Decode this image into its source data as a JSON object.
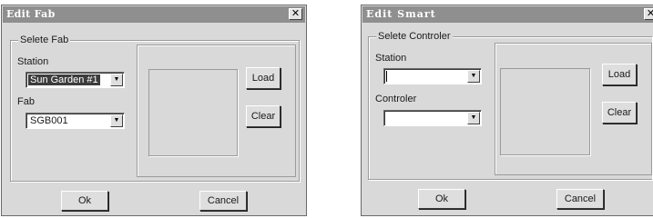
{
  "edit_fab": {
    "title": "Edit Fab",
    "close_symbol": "✕",
    "group_title": "Selete Fab",
    "station": {
      "label": "Station",
      "value": "Sun Garden #1"
    },
    "fab": {
      "label": "Fab",
      "value": "SGB001"
    },
    "load_label": "Load",
    "clear_label": "Clear",
    "ok_label": "Ok",
    "cancel_label": "Cancel"
  },
  "edit_smart": {
    "title": "Edit Smart",
    "close_symbol": "✕",
    "group_title": "Selete Controler",
    "station": {
      "label": "Station",
      "value": ""
    },
    "controler": {
      "label": "Controler",
      "value": ""
    },
    "load_label": "Load",
    "clear_label": "Clear",
    "ok_label": "Ok",
    "cancel_label": "Cancel"
  },
  "icons": {
    "dropdown": "▼"
  },
  "colors": {
    "titlebar": "#8f8f8f",
    "dialog_bg": "#d9d9d9",
    "selection": "#3c3c3c"
  }
}
